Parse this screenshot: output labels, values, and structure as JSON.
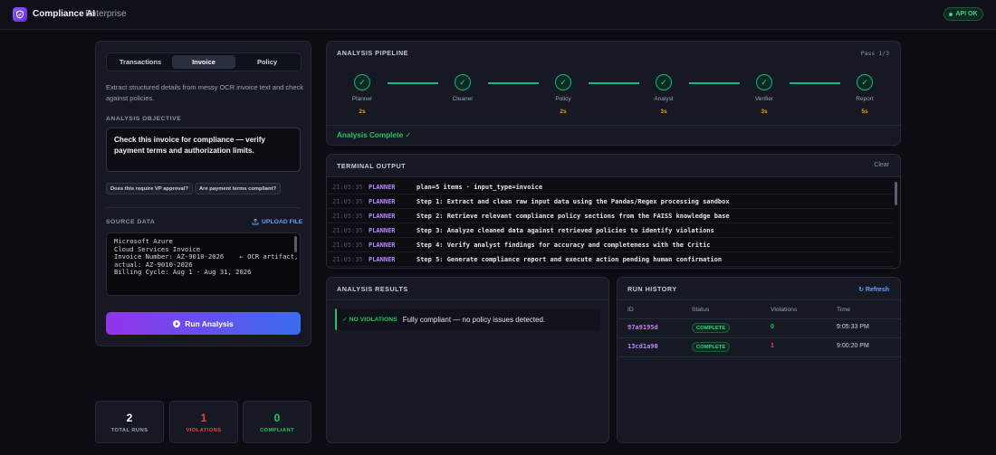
{
  "header": {
    "app_name": "Compliance AI",
    "tier": "Enterprise",
    "api_status": "API OK"
  },
  "left": {
    "tabs": [
      "Transactions",
      "Invoice",
      "Policy"
    ],
    "active_tab": "Invoice",
    "description": "Extract structured details from messy OCR invoice text and check against policies.",
    "objective_label": "ANALYSIS OBJECTIVE",
    "objective_text": "Check this invoice for compliance — verify payment terms and authorization limits.",
    "quick_prompts": [
      "Does this require VP approval?",
      "Are payment terms compliant?"
    ],
    "source_label": "SOURCE DATA",
    "upload_label": "UPLOAD FILE",
    "source_lines": [
      "Microsoft Azure",
      "Cloud Services Invoice",
      "",
      "Invoice Number: AZ-9010-2026    ← OCR artifact,",
      "actual: AZ-9010-2026",
      "Billing Cycle: Aug 1 - Aug 31, 2026"
    ],
    "run_label": "Run Analysis"
  },
  "stats": [
    {
      "value": "2",
      "label": "TOTAL RUNS",
      "color": "#ffffff"
    },
    {
      "value": "1",
      "label": "VIOLATIONS",
      "color": "#ef4444"
    },
    {
      "value": "0",
      "label": "COMPLIANT",
      "color": "#22c55e"
    }
  ],
  "pipeline": {
    "title": "ANALYSIS PIPELINE",
    "pass": "Pass 1/3",
    "stages": [
      {
        "name": "Planner",
        "time": "2s"
      },
      {
        "name": "Cleaner",
        "time": ""
      },
      {
        "name": "Policy",
        "time": "2s"
      },
      {
        "name": "Analyst",
        "time": "3s"
      },
      {
        "name": "Verifier",
        "time": "3s"
      },
      {
        "name": "Report",
        "time": "5s"
      }
    ],
    "status": "Analysis Complete ✓"
  },
  "terminal": {
    "title": "TERMINAL OUTPUT",
    "clear_label": "Clear",
    "rows": [
      {
        "time": "21:05:35",
        "tag": "PLANNER",
        "msg": "plan=5 items · input_type=invoice"
      },
      {
        "time": "21:05:35",
        "tag": "PLANNER",
        "msg": "Step 1: Extract and clean raw input data using the Pandas/Regex processing sandbox"
      },
      {
        "time": "21:05:35",
        "tag": "PLANNER",
        "msg": "Step 2: Retrieve relevant compliance policy sections from the FAISS knowledge base"
      },
      {
        "time": "21:05:35",
        "tag": "PLANNER",
        "msg": "Step 3: Analyze cleaned data against retrieved policies to identify violations"
      },
      {
        "time": "21:05:35",
        "tag": "PLANNER",
        "msg": "Step 4: Verify analyst findings for accuracy and completeness with the Critic"
      },
      {
        "time": "21:05:35",
        "tag": "PLANNER",
        "msg": "Step 5: Generate compliance report and execute action pending human confirmation"
      }
    ]
  },
  "results": {
    "title": "ANALYSIS RESULTS",
    "badge": "✓ NO VIOLATIONS",
    "message": "Fully compliant — no policy issues detected."
  },
  "history": {
    "title": "RUN HISTORY",
    "refresh_label": "↻ Refresh",
    "columns": [
      "ID",
      "Status",
      "Violations",
      "Time"
    ],
    "rows": [
      {
        "id": "97a9195d",
        "status": "COMPLETE",
        "violations": "0",
        "violation_color": "#22c55e",
        "time": "9:05:33 PM"
      },
      {
        "id": "13cd1a90",
        "status": "COMPLETE",
        "violations": "1",
        "violation_color": "#ef4444",
        "time": "9:00:20 PM"
      }
    ]
  }
}
